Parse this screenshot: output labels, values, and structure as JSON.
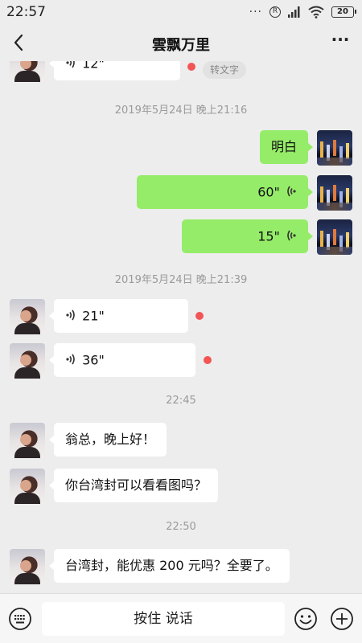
{
  "status": {
    "time": "22:57",
    "battery": "20"
  },
  "header": {
    "title": "雲飘万里"
  },
  "messages": [
    {
      "duration": "12\""
    },
    {
      "duration": "60\""
    },
    {
      "duration": "15\""
    },
    {
      "duration": "21\""
    },
    {
      "duration": "36\""
    }
  ],
  "to_text_label": "转文字",
  "text_messages": [
    "明白",
    "翁总，晚上好！",
    "你台湾封可以看看图吗？",
    "台湾封，能优惠 200 元吗？全要了。"
  ],
  "timestamps": [
    "2019年5月24日 晚上21:16",
    "2019年5月24日 晚上21:39",
    "22:45",
    "22:50"
  ],
  "input": {
    "hold_to_talk": "按住 说话"
  },
  "colors": {
    "self_bubble": "#95ec69",
    "other_bubble": "#ffffff",
    "unread_dot": "#f25555",
    "background": "#ededed"
  },
  "icons": [
    "keyboard-icon",
    "emoji-icon",
    "plus-icon",
    "back-arrow-icon",
    "more-icon",
    "voice-wave-icon",
    "wifi-icon",
    "signal-icon"
  ]
}
